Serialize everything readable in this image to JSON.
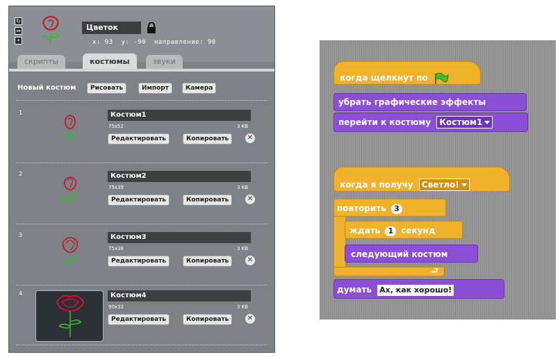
{
  "sprite": {
    "name": "Цветок",
    "x_label": "x: 93",
    "y_label": "y: -90",
    "direction_label": "направление: 90"
  },
  "tabs": [
    {
      "label": "скрипты"
    },
    {
      "label": "костюмы"
    },
    {
      "label": "звуки"
    }
  ],
  "new_costume": {
    "label": "Новый костюм",
    "paint": "Рисовать",
    "import": "Импорт",
    "camera": "Камера"
  },
  "costumes": [
    {
      "num": "1",
      "name": "Костюм1",
      "size": "75x52",
      "kb": "3 KB",
      "edit": "Редактировать",
      "copy": "Копировать"
    },
    {
      "num": "2",
      "name": "Костюм2",
      "size": "75x39",
      "kb": "3 KB",
      "edit": "Редактировать",
      "copy": "Копировать"
    },
    {
      "num": "3",
      "name": "Костюм3",
      "size": "75x38",
      "kb": "3 KB",
      "edit": "Редактировать",
      "copy": "Копировать"
    },
    {
      "num": "4",
      "name": "Костюм4",
      "size": "90x32",
      "kb": "3 KB",
      "edit": "Редактировать",
      "copy": "Копировать"
    }
  ],
  "script1": {
    "hat": "когда щелкнут по",
    "clear": "убрать графические эффекты",
    "switch": "перейти к костюму",
    "switch_value": "Костюм1"
  },
  "script2": {
    "hat": "когда я получу",
    "hat_value": "Светло!",
    "repeat": "повторить",
    "repeat_value": "3",
    "wait": "ждать",
    "wait_value": "1",
    "wait_unit": "секунд",
    "next": "следующий костюм",
    "think": "думать",
    "think_value": "Ах, как хорошо!"
  },
  "colors": {
    "events": "#f0b22a",
    "looks": "#8a4fd6",
    "flag": "#3fbf2f"
  }
}
